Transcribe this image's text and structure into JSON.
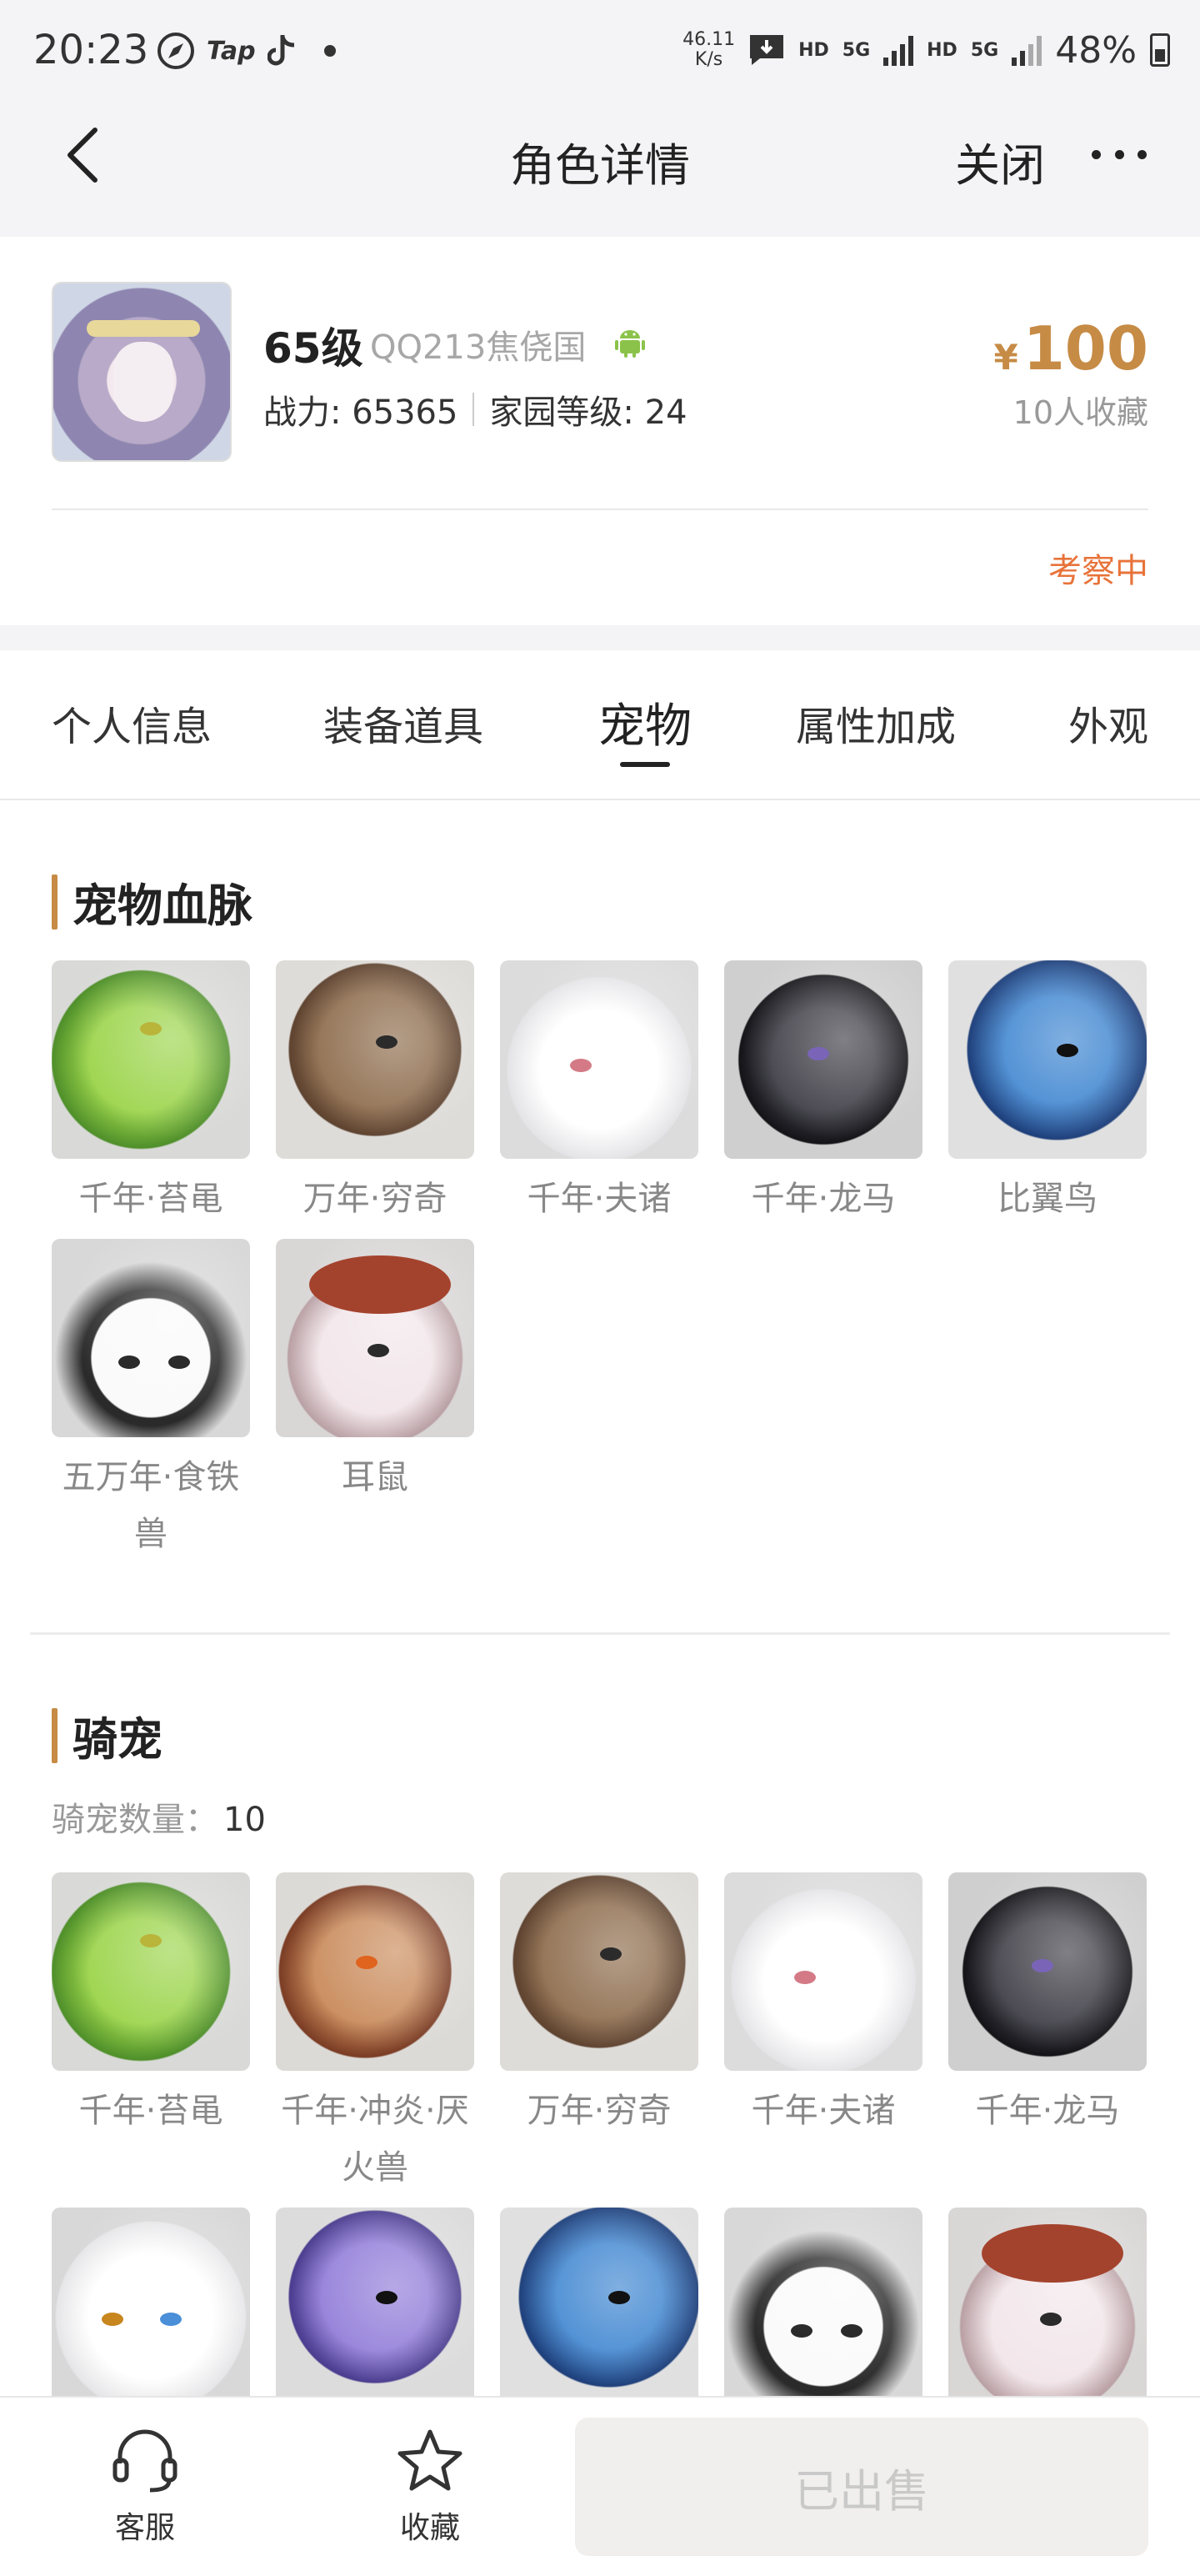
{
  "status_bar": {
    "time": "20:23",
    "tap_label": "Tap",
    "net_speed_value": "46.11",
    "net_speed_unit": "K/s",
    "hd1": "HD",
    "fiveg1": "5G",
    "hd2": "HD",
    "fiveg2": "5G",
    "battery": "48%"
  },
  "nav": {
    "title": "角色详情",
    "close_label": "关闭"
  },
  "role": {
    "level": "65级",
    "server": "QQ213焦侥国",
    "power": "战力: 65365",
    "home_level": "家园等级: 24",
    "price_symbol": "¥",
    "price": "100",
    "favorites": "10人收藏",
    "status": "考察中"
  },
  "tabs": [
    {
      "label": "个人信息"
    },
    {
      "label": "装备道具"
    },
    {
      "label": "宠物",
      "active": true
    },
    {
      "label": "属性加成"
    },
    {
      "label": "外观"
    }
  ],
  "pet_bloodline": {
    "title": "宠物血脉",
    "items": [
      {
        "name": "千年·苔黾",
        "icon": "green-toad-portrait"
      },
      {
        "name": "万年·穷奇",
        "icon": "brown-beast-portrait"
      },
      {
        "name": "千年·夫诸",
        "icon": "white-deer-portrait"
      },
      {
        "name": "千年·龙马",
        "icon": "black-dragon-portrait"
      },
      {
        "name": "比翼鸟",
        "icon": "blue-bird-portrait"
      },
      {
        "name": "五万年·食铁兽",
        "icon": "panda-portrait"
      },
      {
        "name": "耳鼠",
        "icon": "ear-mouse-portrait"
      }
    ]
  },
  "mounts": {
    "title": "骑宠",
    "count_label": "骑宠数量：",
    "count": "10",
    "items": [
      {
        "name": "千年·苔黾",
        "icon": "green-toad-portrait"
      },
      {
        "name": "千年·冲炎·厌火兽",
        "icon": "fire-wolf-portrait"
      },
      {
        "name": "万年·穷奇",
        "icon": "brown-beast-portrait"
      },
      {
        "name": "千年·夫诸",
        "icon": "white-deer-portrait"
      },
      {
        "name": "千年·龙马",
        "icon": "black-dragon-portrait"
      },
      {
        "name": "",
        "icon": "white-cat-portrait"
      },
      {
        "name": "",
        "icon": "purple-bird-portrait"
      },
      {
        "name": "",
        "icon": "blue-bird-portrait"
      },
      {
        "name": "",
        "icon": "panda-portrait"
      },
      {
        "name": "",
        "icon": "ear-mouse-portrait"
      }
    ]
  },
  "bottom_bar": {
    "service_label": "客服",
    "favorite_label": "收藏",
    "sold_label": "已出售"
  }
}
